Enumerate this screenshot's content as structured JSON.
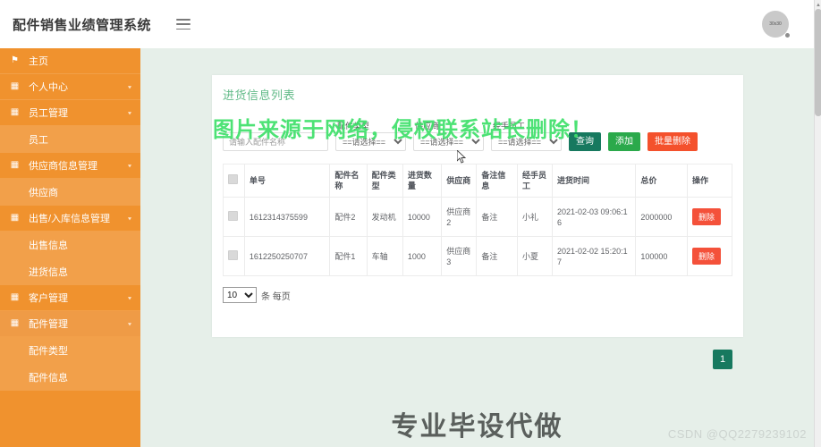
{
  "header": {
    "brand": "配件销售业绩管理系统",
    "menu_icon": "hamburger-icon",
    "avatar_text": "30x30"
  },
  "sidebar": {
    "items": [
      {
        "label": "主页",
        "icon": "flag-icon",
        "type": "item",
        "expandable": false
      },
      {
        "label": "个人中心",
        "icon": "grid-icon",
        "type": "item",
        "expandable": true
      },
      {
        "label": "员工管理",
        "icon": "grid-icon",
        "type": "item",
        "expandable": true
      },
      {
        "label": "员工",
        "icon": "",
        "type": "sub",
        "expandable": false
      },
      {
        "label": "供应商信息管理",
        "icon": "grid-icon",
        "type": "item",
        "expandable": true
      },
      {
        "label": "供应商",
        "icon": "",
        "type": "sub",
        "expandable": false
      },
      {
        "label": "出售/入库信息管理",
        "icon": "grid-icon",
        "type": "item",
        "expandable": true
      },
      {
        "label": "出售信息",
        "icon": "",
        "type": "sub",
        "expandable": false
      },
      {
        "label": "进货信息",
        "icon": "",
        "type": "sub",
        "expandable": false
      },
      {
        "label": "客户管理",
        "icon": "grid-icon",
        "type": "item",
        "expandable": true
      },
      {
        "label": "配件管理",
        "icon": "grid-icon",
        "type": "item",
        "expandable": true,
        "active": true
      },
      {
        "label": "配件类型",
        "icon": "",
        "type": "sub",
        "expandable": false
      },
      {
        "label": "配件信息",
        "icon": "",
        "type": "sub",
        "expandable": false
      }
    ]
  },
  "card": {
    "title": "进货信息列表",
    "search": {
      "name_placeholder": "请输入配件名称",
      "name_value": "",
      "filters": [
        {
          "label": "配件类型",
          "value": "==请选择=="
        },
        {
          "label": "供应商",
          "value": "==请选择=="
        },
        {
          "label": "经手员工",
          "value": "==请选择=="
        }
      ],
      "buttons": {
        "query": "查询",
        "add": "添加",
        "bulk_delete": "批量删除"
      }
    },
    "table": {
      "columns": [
        "",
        "单号",
        "配件名称",
        "配件类型",
        "进货数量",
        "供应商",
        "备注信息",
        "经手员工",
        "进货时间",
        "总价",
        "操作"
      ],
      "rows": [
        {
          "order_no": "1612314375599",
          "part_name": "配件2",
          "part_type": "发动机",
          "quantity": "10000",
          "supplier": "供应商2",
          "remark": "备注",
          "staff": "小礼",
          "time": "2021-02-03 09:06:16",
          "total": "2000000",
          "action": "删除"
        },
        {
          "order_no": "1612250250707",
          "part_name": "配件1",
          "part_type": "车轴",
          "quantity": "1000",
          "supplier": "供应商3",
          "remark": "备注",
          "staff": "小夏",
          "time": "2021-02-02 15:20:17",
          "total": "100000",
          "action": "删除"
        }
      ]
    },
    "pager": {
      "page_size": "10",
      "page_size_label": "条 每页",
      "current_page": "1"
    }
  },
  "overlays": {
    "green_watermark": "图片来源于网络，侵权联系站长删除！",
    "big_text": "专业毕设代做",
    "csdn_watermark": "CSDN @QQ2279239102"
  },
  "colors": {
    "sidebar": "#f0922e",
    "accent_green": "#63bb89",
    "btn_query": "#17795f",
    "btn_add": "#2ba94b",
    "btn_delete": "#f4513a",
    "content_bg": "#e6efe9",
    "watermark_green": "#3ee06a"
  }
}
